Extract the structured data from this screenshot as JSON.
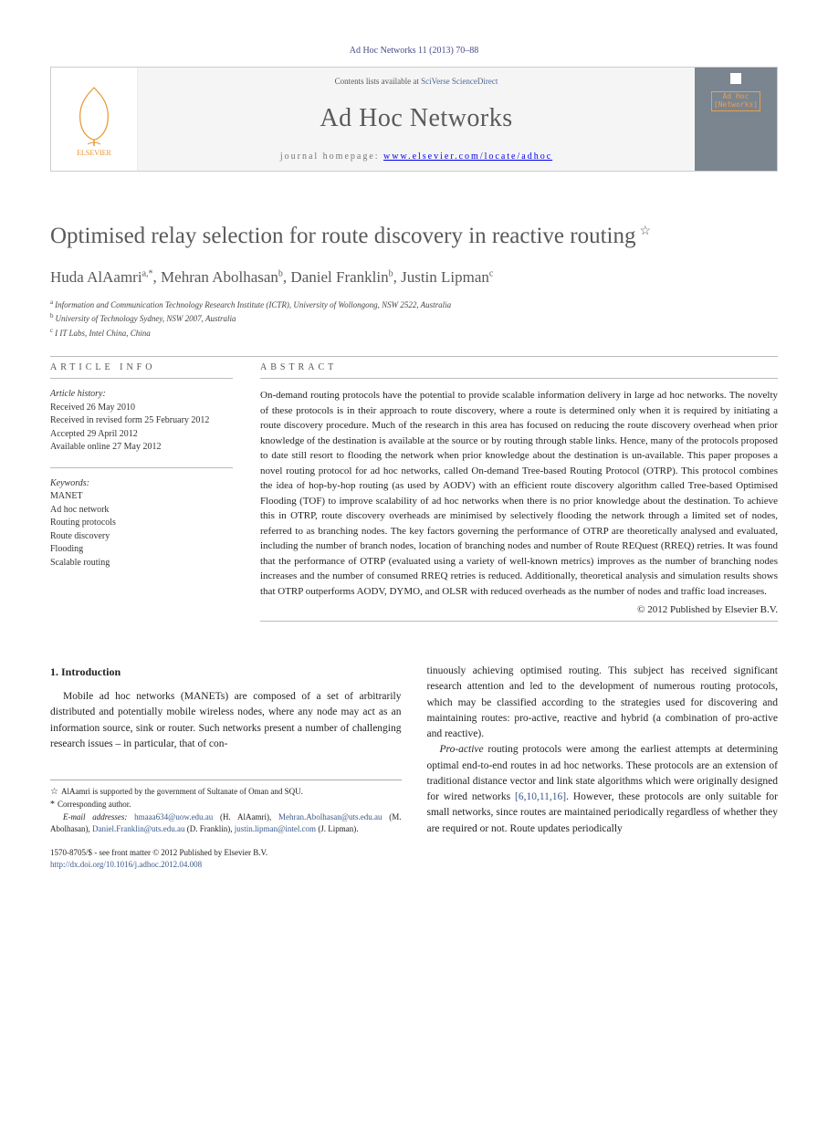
{
  "header_citation": "Ad Hoc Networks 11 (2013) 70–88",
  "banner": {
    "contents_prefix": "Contents lists available at ",
    "contents_link": "SciVerse ScienceDirect",
    "journal": "Ad Hoc Networks",
    "homepage_label": "journal homepage: ",
    "homepage_url": "www.elsevier.com/locate/adhoc",
    "cover_text": "Ad Hoc\n[Networks]"
  },
  "title": "Optimised relay selection for route discovery in reactive routing",
  "title_note_symbol": "☆",
  "authors_html": [
    {
      "name": "Huda AlAamri",
      "marks": "a,*"
    },
    {
      "name": "Mehran Abolhasan",
      "marks": "b"
    },
    {
      "name": "Daniel Franklin",
      "marks": "b"
    },
    {
      "name": "Justin Lipman",
      "marks": "c"
    }
  ],
  "affiliations": [
    {
      "mark": "a",
      "text": "Information and Communication Technology Research Institute (ICTR), University of Wollongong, NSW 2522, Australia"
    },
    {
      "mark": "b",
      "text": "University of Technology Sydney, NSW 2007, Australia"
    },
    {
      "mark": "c",
      "text": "I IT Labs, Intel China, China"
    }
  ],
  "info": {
    "heading": "ARTICLE INFO",
    "history_label": "Article history:",
    "history": [
      "Received 26 May 2010",
      "Received in revised form 25 February 2012",
      "Accepted 29 April 2012",
      "Available online 27 May 2012"
    ],
    "keywords_label": "Keywords:",
    "keywords": [
      "MANET",
      "Ad hoc network",
      "Routing protocols",
      "Route discovery",
      "Flooding",
      "Scalable routing"
    ]
  },
  "abstract": {
    "heading": "ABSTRACT",
    "text": "On-demand routing protocols have the potential to provide scalable information delivery in large ad hoc networks. The novelty of these protocols is in their approach to route discovery, where a route is determined only when it is required by initiating a route discovery procedure. Much of the research in this area has focused on reducing the route discovery overhead when prior knowledge of the destination is available at the source or by routing through stable links. Hence, many of the protocols proposed to date still resort to flooding the network when prior knowledge about the destination is un-available. This paper proposes a novel routing protocol for ad hoc networks, called On-demand Tree-based Routing Protocol (OTRP). This protocol combines the idea of hop-by-hop routing (as used by AODV) with an efficient route discovery algorithm called Tree-based Optimised Flooding (TOF) to improve scalability of ad hoc networks when there is no prior knowledge about the destination. To achieve this in OTRP, route discovery overheads are minimised by selectively flooding the network through a limited set of nodes, referred to as branching nodes. The key factors governing the performance of OTRP are theoretically analysed and evaluated, including the number of branch nodes, location of branching nodes and number of Route REQuest (RREQ) retries. It was found that the performance of OTRP (evaluated using a variety of well-known metrics) improves as the number of branching nodes increases and the number of consumed RREQ retries is reduced. Additionally, theoretical analysis and simulation results shows that OTRP outperforms AODV, DYMO, and OLSR with reduced overheads as the number of nodes and traffic load increases.",
    "copyright": "© 2012 Published by Elsevier B.V."
  },
  "section1": {
    "heading": "1. Introduction",
    "para1": "Mobile ad hoc networks (MANETs) are composed of a set of arbitrarily distributed and potentially mobile wireless nodes, where any node may act as an information source, sink or router. Such networks present a number of challenging research issues – in particular, that of con-",
    "para1b": "tinuously achieving optimised routing. This subject has received significant research attention and led to the development of numerous routing protocols, which may be classified according to the strategies used for discovering and maintaining routes: pro-active, reactive and hybrid (a combination of pro-active and reactive).",
    "para2_pre": "Pro-active",
    "para2": " routing protocols were among the earliest attempts at determining optimal end-to-end routes in ad hoc networks. These protocols are an extension of traditional distance vector and link state algorithms which were originally designed for wired networks ",
    "para2_refs": "[6,10,11,16]",
    "para2_post": ". However, these protocols are only suitable for small networks, since routes are maintained periodically regardless of whether they are required or not. Route updates periodically"
  },
  "footnotes": {
    "funding_symbol": "☆",
    "funding": "AlAamri is supported by the government of Sultanate of Oman and SQU.",
    "corr_symbol": "*",
    "corr": "Corresponding author.",
    "email_label": "E-mail addresses:",
    "emails": [
      {
        "addr": "hmaaa634@uow.edu.au",
        "who": "(H. AlAamri)"
      },
      {
        "addr": "Mehran.Abolhasan@uts.edu.au",
        "who": "(M. Abolhasan)"
      },
      {
        "addr": "Daniel.Franklin@uts.edu.au",
        "who": "(D. Franklin)"
      },
      {
        "addr": "justin.lipman@intel.com",
        "who": "(J. Lipman)"
      }
    ]
  },
  "frontmatter": {
    "line1": "1570-8705/$ - see front matter © 2012 Published by Elsevier B.V.",
    "doi": "http://dx.doi.org/10.1016/j.adhoc.2012.04.008"
  }
}
